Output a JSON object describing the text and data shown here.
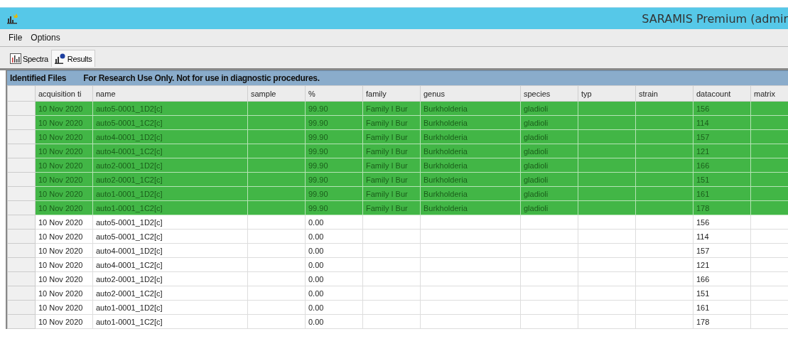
{
  "window": {
    "title": "SARAMIS Premium (admir"
  },
  "menu": [
    "File",
    "Options"
  ],
  "tabs": [
    {
      "label": "Spectra",
      "selected": false,
      "kind": "spectra"
    },
    {
      "label": "Results",
      "selected": true,
      "kind": "results"
    }
  ],
  "panel": {
    "title": "Identified Files",
    "notice": "For Research Use Only. Not for use in diagnostic procedures."
  },
  "table": {
    "columns": [
      "acquisition ti",
      "name",
      "sample",
      "%",
      "family",
      "genus",
      "species",
      "typ",
      "strain",
      "datacount",
      "matrix"
    ],
    "rows": [
      {
        "highlighted": true,
        "cells": [
          "10 Nov 2020",
          "auto5-0001_1D2[c]",
          "",
          "99.90",
          "Family I Bur",
          "Burkholderia",
          "gladioli",
          "",
          "",
          "156",
          ""
        ]
      },
      {
        "highlighted": true,
        "cells": [
          "10 Nov 2020",
          "auto5-0001_1C2[c]",
          "",
          "99.90",
          "Family I Bur",
          "Burkholderia",
          "gladioli",
          "",
          "",
          "114",
          ""
        ]
      },
      {
        "highlighted": true,
        "cells": [
          "10 Nov 2020",
          "auto4-0001_1D2[c]",
          "",
          "99.90",
          "Family I Bur",
          "Burkholderia",
          "gladioli",
          "",
          "",
          "157",
          ""
        ]
      },
      {
        "highlighted": true,
        "cells": [
          "10 Nov 2020",
          "auto4-0001_1C2[c]",
          "",
          "99.90",
          "Family I Bur",
          "Burkholderia",
          "gladioli",
          "",
          "",
          "121",
          ""
        ]
      },
      {
        "highlighted": true,
        "cells": [
          "10 Nov 2020",
          "auto2-0001_1D2[c]",
          "",
          "99.90",
          "Family I Bur",
          "Burkholderia",
          "gladioli",
          "",
          "",
          "166",
          ""
        ]
      },
      {
        "highlighted": true,
        "cells": [
          "10 Nov 2020",
          "auto2-0001_1C2[c]",
          "",
          "99.90",
          "Family I Bur",
          "Burkholderia",
          "gladioli",
          "",
          "",
          "151",
          ""
        ]
      },
      {
        "highlighted": true,
        "cells": [
          "10 Nov 2020",
          "auto1-0001_1D2[c]",
          "",
          "99.90",
          "Family I Bur",
          "Burkholderia",
          "gladioli",
          "",
          "",
          "161",
          ""
        ]
      },
      {
        "highlighted": true,
        "cells": [
          "10 Nov 2020",
          "auto1-0001_1C2[c]",
          "",
          "99.90",
          "Family I Bur",
          "Burkholderia",
          "gladioli",
          "",
          "",
          "178",
          ""
        ]
      },
      {
        "highlighted": false,
        "cells": [
          "10 Nov 2020",
          "auto5-0001_1D2[c]",
          "",
          "0.00",
          "",
          "",
          "",
          "",
          "",
          "156",
          ""
        ]
      },
      {
        "highlighted": false,
        "cells": [
          "10 Nov 2020",
          "auto5-0001_1C2[c]",
          "",
          "0.00",
          "",
          "",
          "",
          "",
          "",
          "114",
          ""
        ]
      },
      {
        "highlighted": false,
        "cells": [
          "10 Nov 2020",
          "auto4-0001_1D2[c]",
          "",
          "0.00",
          "",
          "",
          "",
          "",
          "",
          "157",
          ""
        ]
      },
      {
        "highlighted": false,
        "cells": [
          "10 Nov 2020",
          "auto4-0001_1C2[c]",
          "",
          "0.00",
          "",
          "",
          "",
          "",
          "",
          "121",
          ""
        ]
      },
      {
        "highlighted": false,
        "cells": [
          "10 Nov 2020",
          "auto2-0001_1D2[c]",
          "",
          "0.00",
          "",
          "",
          "",
          "",
          "",
          "166",
          ""
        ]
      },
      {
        "highlighted": false,
        "cells": [
          "10 Nov 2020",
          "auto2-0001_1C2[c]",
          "",
          "0.00",
          "",
          "",
          "",
          "",
          "",
          "151",
          ""
        ]
      },
      {
        "highlighted": false,
        "cells": [
          "10 Nov 2020",
          "auto1-0001_1D2[c]",
          "",
          "0.00",
          "",
          "",
          "",
          "",
          "",
          "161",
          ""
        ]
      },
      {
        "highlighted": false,
        "cells": [
          "10 Nov 2020",
          "auto1-0001_1C2[c]",
          "",
          "0.00",
          "",
          "",
          "",
          "",
          "",
          "178",
          ""
        ]
      }
    ]
  }
}
